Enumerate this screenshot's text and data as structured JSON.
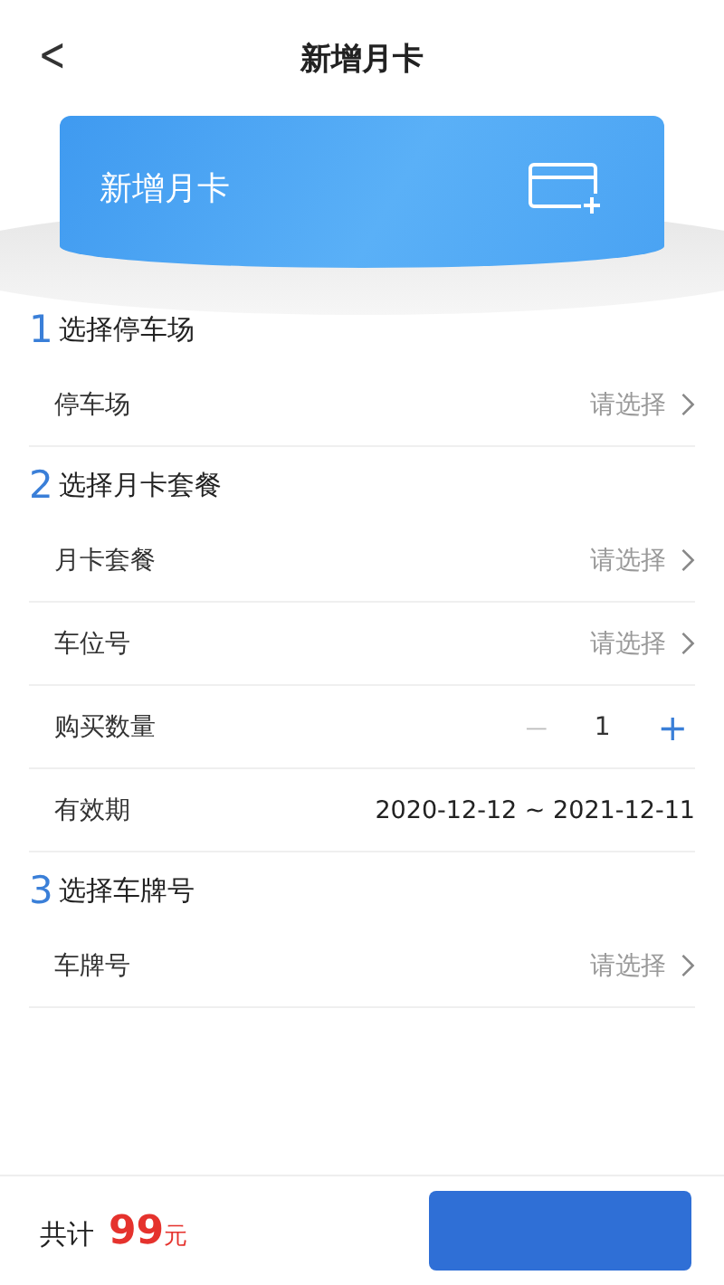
{
  "header": {
    "back": "<",
    "title": "新增月卡"
  },
  "banner": {
    "title": "新增月卡"
  },
  "sections": [
    {
      "number": "1",
      "title": "选择停车场",
      "rows": [
        {
          "kind": "select",
          "label": "停车场",
          "placeholder": "请选择"
        }
      ]
    },
    {
      "number": "2",
      "title": "选择月卡套餐",
      "rows": [
        {
          "kind": "select",
          "label": "月卡套餐",
          "placeholder": "请选择"
        },
        {
          "kind": "select",
          "label": "车位号",
          "placeholder": "请选择"
        },
        {
          "kind": "stepper",
          "label": "购买数量",
          "minus": "—",
          "count": "1",
          "plus": "+"
        },
        {
          "kind": "text",
          "label": "有效期",
          "value": "2020-12-12 ~ 2021-12-11"
        }
      ]
    },
    {
      "number": "3",
      "title": "选择车牌号",
      "rows": [
        {
          "kind": "select",
          "label": "车牌号",
          "placeholder": "请选择"
        }
      ]
    }
  ],
  "footer": {
    "total_label": "共计",
    "amount": "99",
    "unit": "元"
  }
}
